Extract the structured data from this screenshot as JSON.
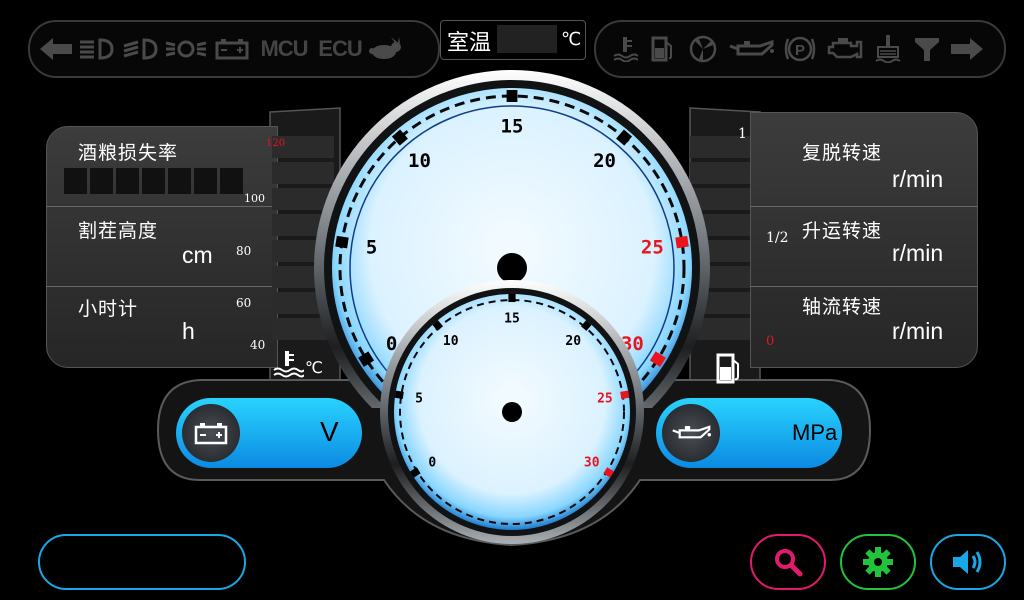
{
  "top_left_indicators": [
    "turn-left-arrow-icon",
    "high-beam-icon",
    "low-beam-icon",
    "parking-light-icon",
    "battery-icon",
    "mcu",
    "ecu",
    "rabbit-speed-icon"
  ],
  "mcu_label": "MCU",
  "ecu_label": "ECU",
  "top_right_indicators": [
    "water-temp-icon",
    "fuel-icon",
    "fan-icon",
    "oil-can-icon",
    "parking-brake-icon",
    "engine-icon",
    "coolant-icon",
    "air-filter-icon",
    "turn-right-arrow-icon"
  ],
  "room_temp": {
    "label": "室温",
    "value": "",
    "unit": "℃"
  },
  "left_panel": {
    "grain_loss": {
      "label": "酒粮损失率",
      "segments": 7
    },
    "stubble": {
      "label": "割茬高度",
      "unit": "cm"
    },
    "hour_meter": {
      "label": "小时计",
      "unit": "h"
    }
  },
  "right_panel": {
    "rethresh": {
      "label": "复脱转速",
      "unit": "r/min"
    },
    "elevator": {
      "label": "升运转速",
      "unit": "r/min"
    },
    "axial": {
      "label": "轴流转速",
      "unit": "r/min"
    }
  },
  "temp_gauge": {
    "ticks": [
      "120",
      "100",
      "80",
      "60",
      "40"
    ],
    "unit": "℃"
  },
  "fuel_gauge": {
    "ticks": [
      "1",
      "1/2",
      "0"
    ]
  },
  "main_gauge": {
    "labels": [
      "0",
      "5",
      "10",
      "15",
      "20",
      "25",
      "30"
    ],
    "red_from": 25
  },
  "sub_gauge": {
    "labels": [
      "0",
      "5",
      "10",
      "15",
      "20",
      "25",
      "30"
    ],
    "red_from": 25
  },
  "voltage": {
    "unit": "V",
    "value": ""
  },
  "oil_pressure": {
    "unit": "MPa",
    "value": ""
  },
  "bottom_buttons": {
    "search": "search-icon",
    "settings": "gear-icon",
    "volume": "volume-icon"
  },
  "colors": {
    "accent": "#1fc6ff",
    "danger": "#e8141e",
    "magenta": "#e21a6e",
    "green": "#21c33a"
  }
}
